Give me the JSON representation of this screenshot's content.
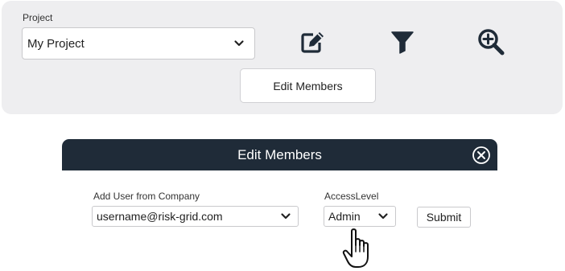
{
  "project": {
    "label": "Project",
    "selected": "My Project",
    "edit_members_label": "Edit Members",
    "icons": [
      "edit-icon",
      "filter-icon",
      "zoom-in-icon"
    ]
  },
  "modal": {
    "title": "Edit Members",
    "add_user_label": "Add User from Company",
    "add_user_value": "username@risk-grid.com",
    "access_level_label": "AccessLevel",
    "access_level_value": "Admin",
    "submit_label": "Submit"
  },
  "colors": {
    "panel_bg": "#eeeef0",
    "modal_header_bg": "#1f2b38",
    "icon_color": "#1f2b38"
  }
}
